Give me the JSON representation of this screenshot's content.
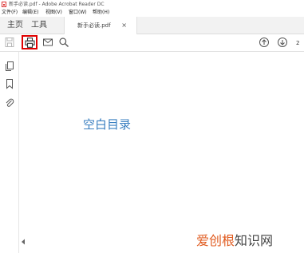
{
  "window": {
    "title": "新手必读.pdf - Adobe Acrobat Reader DC"
  },
  "menubar": {
    "items": [
      "文件(F)",
      "编辑(E)",
      "视图(V)",
      "窗口(W)",
      "帮助(H)"
    ]
  },
  "tabs": {
    "home": "主页",
    "tools": "工具",
    "document": "新手必读.pdf",
    "close": "×"
  },
  "toolbar": {
    "icons": [
      "save-icon",
      "print-icon",
      "email-icon",
      "search-icon",
      "page-up-icon",
      "page-down-icon"
    ],
    "page_number": "2",
    "highlight_color": "#e00000"
  },
  "sidepanel": {
    "icons": [
      "copy-pages-icon",
      "bookmark-icon",
      "attachment-icon"
    ]
  },
  "content": {
    "empty_outline_text": "空白目录",
    "text_color": "#3a7fc0"
  },
  "watermark": {
    "brand_part": "爱创根",
    "brand_color": "#e05a1e",
    "suffix_part": "知识网",
    "suffix_color": "#444444"
  }
}
